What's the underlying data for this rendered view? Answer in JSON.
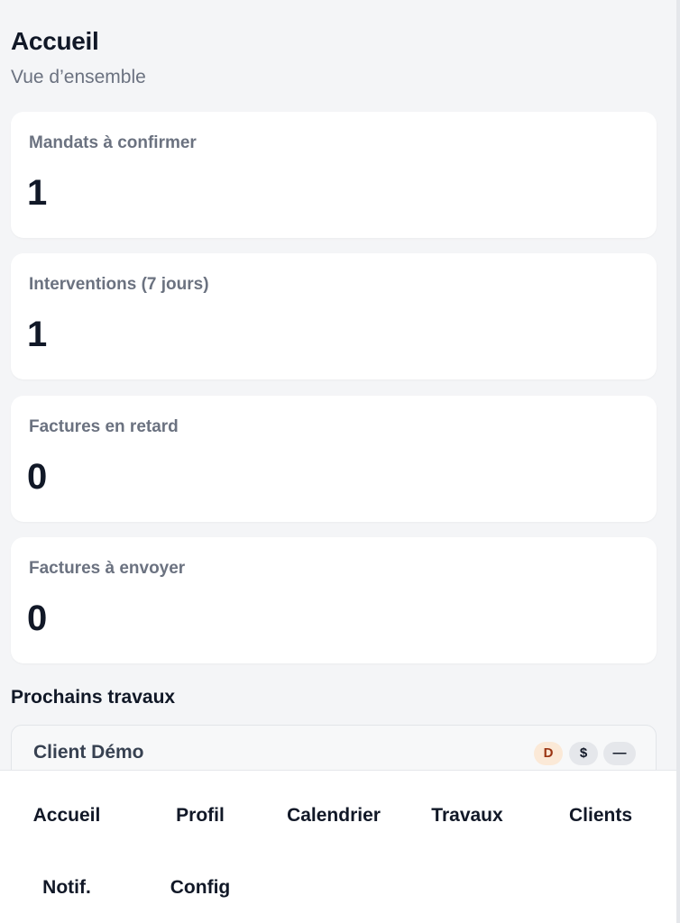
{
  "header": {
    "title": "Accueil",
    "subtitle": "Vue d’ensemble"
  },
  "stats": [
    {
      "label": "Mandats à confirmer",
      "value": "1"
    },
    {
      "label": "Interventions (7 jours)",
      "value": "1"
    },
    {
      "label": "Factures en retard",
      "value": "0"
    },
    {
      "label": "Factures à envoyer",
      "value": "0"
    }
  ],
  "upcoming": {
    "title": "Prochains travaux",
    "items": [
      {
        "client": "Client Démo",
        "badges": [
          "D",
          "$",
          "—"
        ]
      }
    ]
  },
  "nav": {
    "items": [
      "Accueil",
      "Profil",
      "Calendrier",
      "Travaux",
      "Clients",
      "Notif.",
      "Config"
    ]
  },
  "colors": {
    "accent_badge_bg": "#fbe9d7",
    "accent_badge_text": "#9a3412",
    "page_bg": "#f4f5f7"
  }
}
